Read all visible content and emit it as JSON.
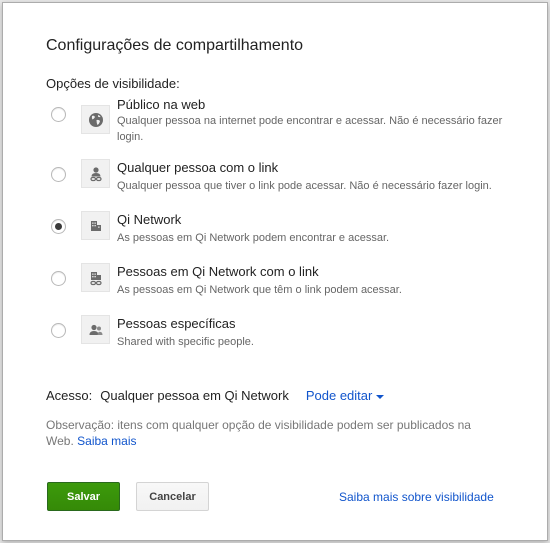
{
  "dialog": {
    "title": "Configurações de compartilhamento",
    "section_label": "Opções de visibilidade:"
  },
  "options": [
    {
      "title": "Público na web",
      "description": "Qualquer pessoa na internet pode encontrar e acessar. Não é necessário fazer login.",
      "icon": "globe-icon",
      "selected": false
    },
    {
      "title": "Qualquer pessoa com o link",
      "description": "Qualquer pessoa que tiver o link pode acessar. Não é necessário fazer login.",
      "icon": "person-link-icon",
      "selected": false
    },
    {
      "title": "Qi Network",
      "description": "As pessoas em Qi Network podem encontrar e acessar.",
      "icon": "building-icon",
      "selected": true
    },
    {
      "title": "Pessoas em Qi Network com o link",
      "description": "As pessoas em Qi Network que têm o link podem acessar.",
      "icon": "building-link-icon",
      "selected": false
    },
    {
      "title": "Pessoas específicas",
      "description": "Shared with specific people.",
      "icon": "people-icon",
      "selected": false
    }
  ],
  "access": {
    "label": "Acesso:",
    "value": "Qualquer pessoa em Qi Network",
    "permission": "Pode editar"
  },
  "note": {
    "text": "Observação: itens com qualquer opção de visibilidade podem ser publicados na Web.",
    "link": "Saiba mais"
  },
  "buttons": {
    "save": "Salvar",
    "cancel": "Cancelar"
  },
  "footer_link": "Saiba mais sobre visibilidade",
  "colors": {
    "save_button": "#3d9400",
    "link": "#1155cc"
  }
}
